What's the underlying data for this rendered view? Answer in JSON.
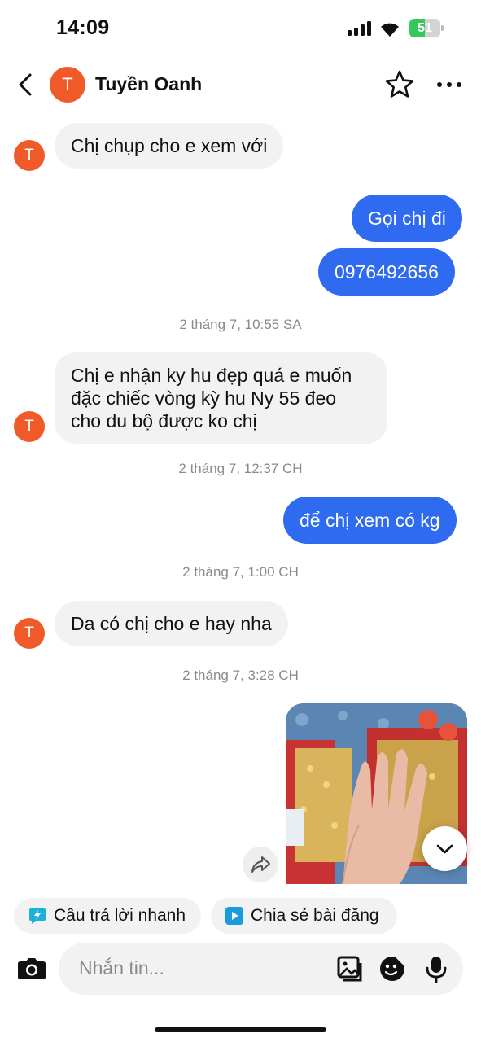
{
  "status_bar": {
    "time": "14:09",
    "battery": "51",
    "battery_level": 0.51
  },
  "header": {
    "name": "Tuyền Oanh",
    "avatar_letter": "T",
    "back_icon": "chevron-left-icon",
    "star_icon": "star-icon",
    "more_icon": "more-horizontal-icon"
  },
  "messages": {
    "m1": "Chị chụp cho e xem với",
    "m2": "Gọi chị đi",
    "m3": "0976492656",
    "ts1": "2 tháng 7, 10:55 SA",
    "m4_line1": "Chị e nhận ky hu đẹp quá e muốn",
    "m4_line2": "đặc chiếc vòng kỳ hu Ny 55 đeo",
    "m4_line3": "cho du bộ được ko chị",
    "ts2": "2 tháng 7, 12:37 CH",
    "m5": "để chị xem có kg",
    "ts3": "2 tháng 7, 1:00 CH",
    "m6": "Da có chị cho e hay nha",
    "ts4": "2 tháng 7, 3:28 CH"
  },
  "quick_chips": {
    "quick_reply": "Câu trả lời nhanh",
    "share_post": "Chia sẻ bài đăng"
  },
  "composer": {
    "placeholder": "Nhắn tin..."
  },
  "colors": {
    "accent": "#2e6bf0",
    "avatar": "#f05a28",
    "bubble_in": "#f2f2f2",
    "timestamp": "#8a8a8a",
    "battery": "#34c759"
  }
}
